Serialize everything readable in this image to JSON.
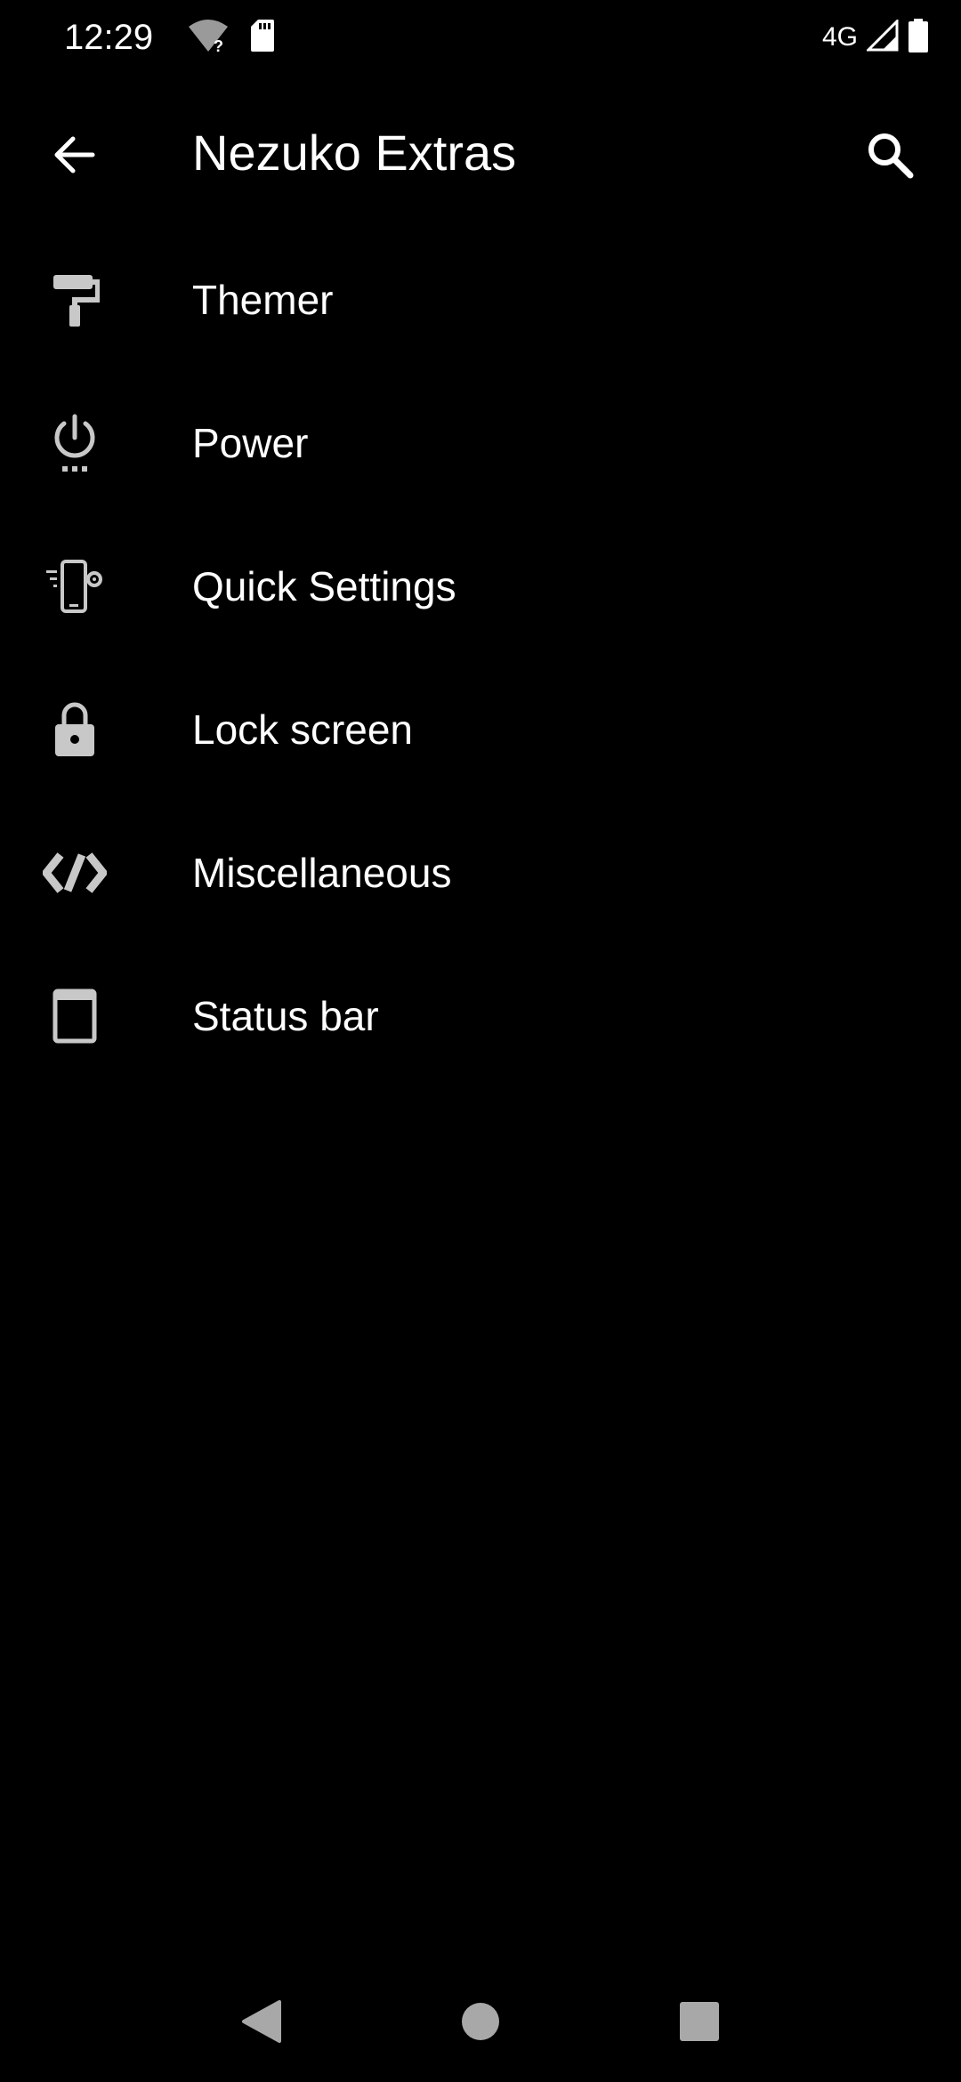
{
  "status_bar": {
    "time": "12:29",
    "network": "4G",
    "icons": [
      "wifi-unknown-icon",
      "sd-card-icon",
      "signal-icon",
      "battery-icon"
    ]
  },
  "app_bar": {
    "title": "Nezuko Extras",
    "back_icon": "arrow-back-icon",
    "search_icon": "search-icon"
  },
  "settings": {
    "items": [
      {
        "label": "Themer",
        "icon": "paint-roller-icon"
      },
      {
        "label": "Power",
        "icon": "power-icon"
      },
      {
        "label": "Quick Settings",
        "icon": "phone-settings-icon"
      },
      {
        "label": "Lock screen",
        "icon": "lock-icon"
      },
      {
        "label": "Miscellaneous",
        "icon": "code-icon"
      },
      {
        "label": "Status bar",
        "icon": "window-icon"
      }
    ]
  },
  "nav_bar": {
    "icons": [
      "back-triangle-icon",
      "home-circle-icon",
      "recents-square-icon"
    ]
  },
  "colors": {
    "background": "#000000",
    "text": "#ffffff",
    "icon": "#c8c8c8"
  }
}
